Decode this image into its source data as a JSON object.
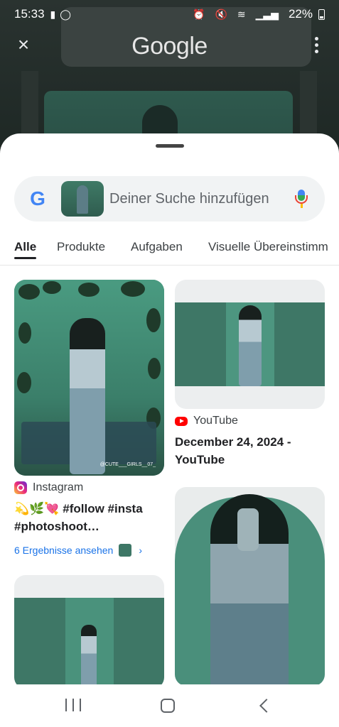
{
  "status_bar": {
    "time": "15:33",
    "battery": "22%"
  },
  "top_bar": {
    "logo_text": "Google"
  },
  "search": {
    "placeholder": "Deiner Suche hinzufügen"
  },
  "tabs": [
    {
      "label": "Alle",
      "active": true
    },
    {
      "label": "Produkte"
    },
    {
      "label": "Aufgaben"
    },
    {
      "label": "Visuelle Übereinstimm"
    }
  ],
  "results": [
    {
      "source": "Instagram",
      "title_emoji": "💫🌿💘",
      "title": "#follow #insta #photoshoot…",
      "watermark": "@CUTE___GIRLS__07_",
      "more_link": "6 Ergebnisse ansehen"
    },
    {
      "source": "YouTube",
      "title": "December 24, 2024 - YouTube"
    }
  ],
  "colors": {
    "accent_link": "#1a73e8",
    "youtube_red": "#ff0000",
    "teal_image": "#3e7766"
  }
}
